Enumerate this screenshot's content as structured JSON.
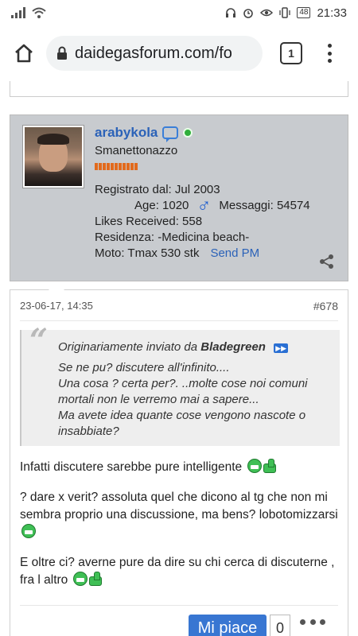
{
  "status_bar": {
    "signal": "4G",
    "battery": "48",
    "time": "21:33"
  },
  "browser": {
    "url": "daidegasforum.com/fo",
    "tab_count": "1"
  },
  "user": {
    "username": "arabykola",
    "title": "Smanettonazzo",
    "registered": "Registrato dal: Jul 2003",
    "age": "Age: 1020",
    "messages": "Messaggi: 54574",
    "likes": "Likes Received: 558",
    "residence": "Residenza: -Medicina beach-",
    "moto": "Moto: Tmax 530 stk",
    "send_pm": "Send PM",
    "male_symbol": "♂"
  },
  "post": {
    "date": "23-06-17, 14:35",
    "number": "#678",
    "quote": {
      "prefix": "Originariamente inviato da",
      "author": "Bladegreen",
      "lines": [
        "Se ne pu? discutere all'infinito....",
        "Una cosa ? certa per?. ..molte cose noi comuni mortali non le verremo mai a sapere...",
        "Ma avete idea quante cose vengono nascote o insabbiate?"
      ]
    },
    "paragraphs": [
      "Infatti discutere sarebbe pure intelligente",
      "? dare x verit? assoluta quel che dicono al tg che non mi sembra proprio una discussione, ma bens? lobotomizzarsi",
      "E oltre ci? averne pure da dire su chi cerca di discuterne , fra l altro"
    ],
    "like_label": "Mi piace",
    "like_count": "0"
  },
  "icons": {
    "home": "home-icon",
    "lock": "lock-icon",
    "menu": "more-vert-icon",
    "share": "share-icon",
    "chat": "chat-icon",
    "online": "online-dot-icon",
    "smiley": "grin-smiley-icon",
    "thumbs": "thumbs-up-icon"
  },
  "colors": {
    "accent": "#3876d2",
    "username": "#2b62b8",
    "online": "#2fae3a",
    "rep": "#e26a1c",
    "userbox_bg": "#c8cbcf"
  }
}
